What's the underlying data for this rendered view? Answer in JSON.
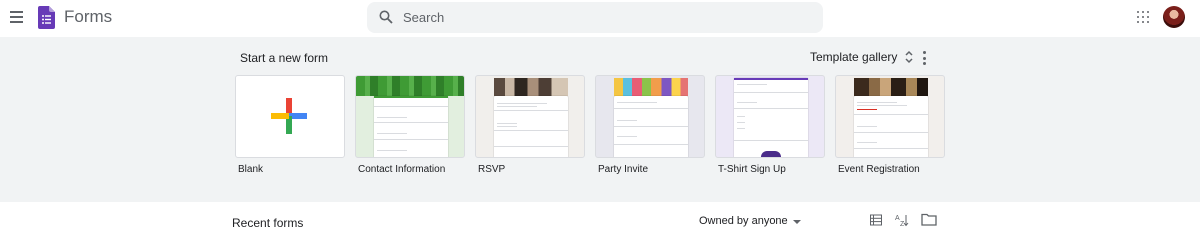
{
  "header": {
    "app_title": "Forms",
    "search_placeholder": "Search",
    "icons": [
      "menu-icon",
      "forms-logo-icon",
      "search-icon",
      "apps-icon",
      "avatar"
    ]
  },
  "templates": {
    "section_title": "Start a new form",
    "gallery_label": "Template gallery",
    "items": [
      {
        "label": "Blank"
      },
      {
        "label": "Contact Information"
      },
      {
        "label": "RSVP"
      },
      {
        "label": "Party Invite"
      },
      {
        "label": "T-Shirt Sign Up"
      },
      {
        "label": "Event Registration"
      }
    ]
  },
  "recent": {
    "title": "Recent forms",
    "owner_filter": "Owned by anyone"
  },
  "colors": {
    "forms_purple": "#673ab7",
    "section_bg": "#f1f3f4",
    "contact_theme": "#e2efdf",
    "rsvp_theme": "#f1efec",
    "party_theme": "#e7e7ee",
    "tshirt_theme": "#ece8f6",
    "event_theme": "#f2efec"
  }
}
